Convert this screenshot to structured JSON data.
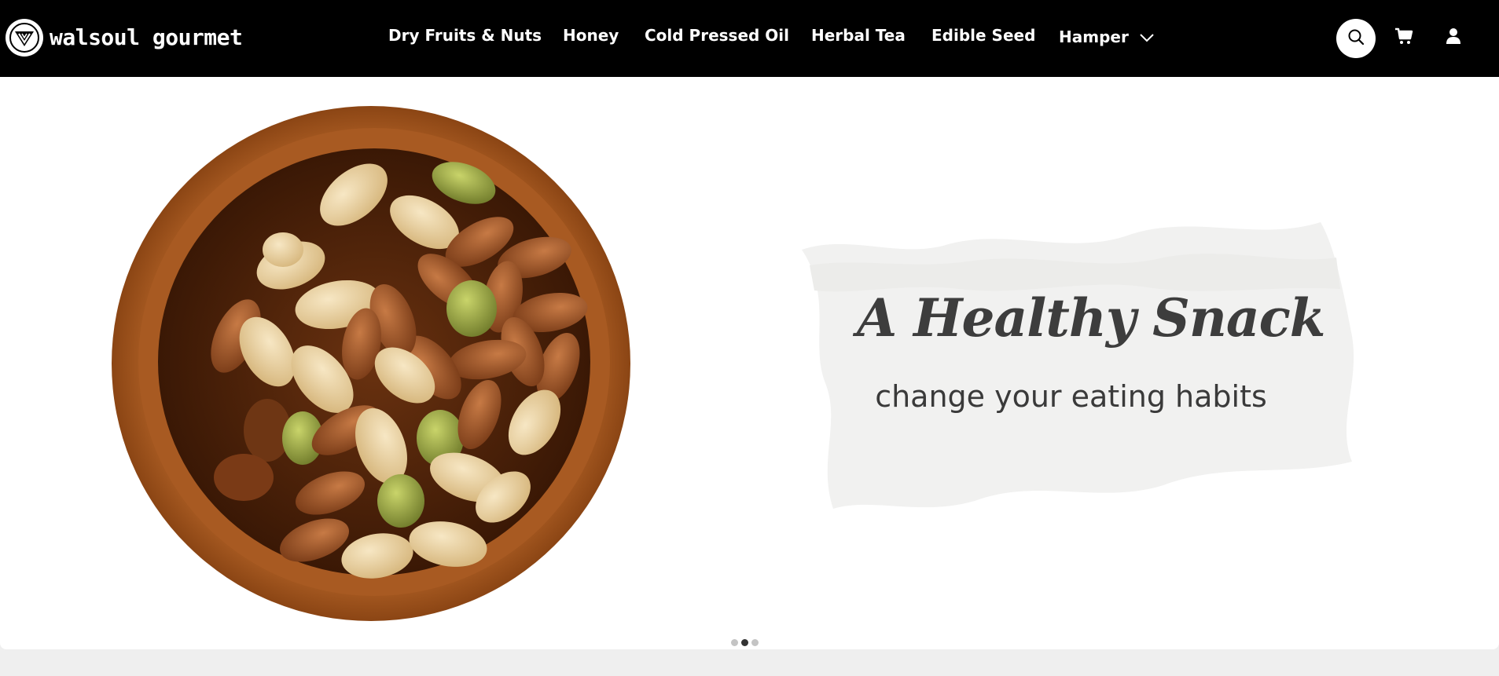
{
  "brand": {
    "name": "walsoul gourmet",
    "logo_icon": "walsoul-logo-icon"
  },
  "nav": {
    "items": [
      {
        "label": "Dry Fruits & Nuts"
      },
      {
        "label": "Honey"
      },
      {
        "label": "Cold Pressed Oil"
      },
      {
        "label": "Herbal Tea"
      },
      {
        "label": "Edible Seed"
      },
      {
        "label": "Hamper",
        "has_dropdown": true,
        "icon": "chevron-down-icon"
      }
    ]
  },
  "header_icons": {
    "search": "search-icon",
    "cart": "cart-icon",
    "account": "user-icon"
  },
  "hero": {
    "headline": "A Healthy Snack",
    "subheadline": "change your eating habits",
    "image": "bowl-of-mixed-nuts",
    "slides": 3,
    "active_slide": 2
  },
  "colors": {
    "header_bg": "#000000",
    "header_text": "#ffffff",
    "page_bg": "#efefef",
    "hero_bg": "#ffffff",
    "headline": "#3d3d3d"
  }
}
